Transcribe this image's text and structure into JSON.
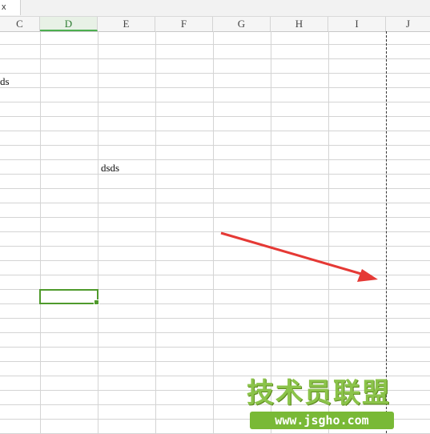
{
  "window": {
    "tab_label": "x"
  },
  "columns": [
    {
      "label": "C",
      "active": false
    },
    {
      "label": "D",
      "active": true
    },
    {
      "label": "E",
      "active": false
    },
    {
      "label": "F",
      "active": false
    },
    {
      "label": "G",
      "active": false
    },
    {
      "label": "H",
      "active": false
    },
    {
      "label": "I",
      "active": false
    },
    {
      "label": "J",
      "active": false
    }
  ],
  "cells": {
    "c_row4": "ds",
    "e_row10": "dsds"
  },
  "watermark": {
    "title": "技术员联盟",
    "url": "www.jsgho.com"
  },
  "colors": {
    "selection": "#4f9a2c",
    "arrow": "#e53935",
    "watermark_green": "#79b936"
  }
}
